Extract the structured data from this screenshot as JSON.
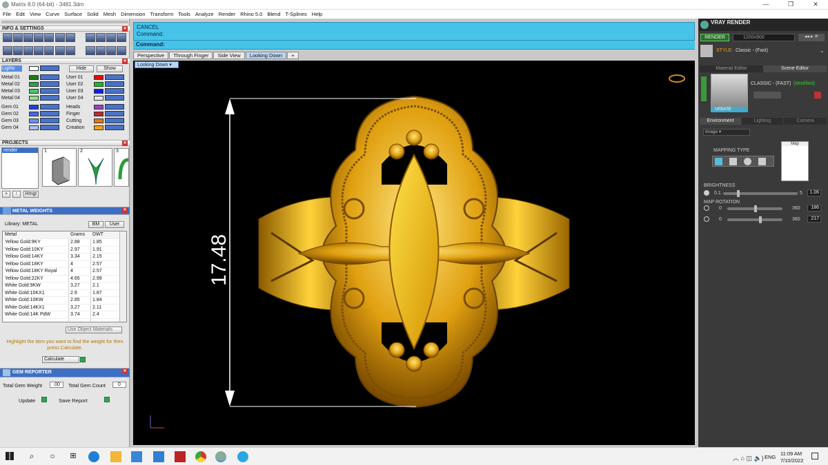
{
  "window": {
    "title": "Matrix 8.0 (64-bit) - 3481.3dm",
    "controls": [
      "—",
      "❐",
      "✕"
    ]
  },
  "menu": [
    "File",
    "Edit",
    "View",
    "Curve",
    "Surface",
    "Solid",
    "Mesh",
    "Dimension",
    "Transform",
    "Tools",
    "Analyze",
    "Render",
    "Rhino 5.0",
    "Blend",
    "T-Splines",
    "Help"
  ],
  "info_settings": {
    "title": "INFO & SETTINGS"
  },
  "layers": {
    "title": "LAYERS",
    "lights_label": "Lights",
    "hide_label": "Hide",
    "show_label": "Show",
    "left": [
      {
        "name": "Metal 01",
        "color": "#1c7a1c"
      },
      {
        "name": "Metal 02",
        "color": "#27a548"
      },
      {
        "name": "Metal 03",
        "color": "#4cc46b"
      },
      {
        "name": "Metal 04",
        "color": "#8fe08f"
      },
      {
        "name": "Gem 01",
        "color": "#1f3fd8"
      },
      {
        "name": "Gem 02",
        "color": "#3f68ef"
      },
      {
        "name": "Gem 03",
        "color": "#6b90f4"
      },
      {
        "name": "Gem 04",
        "color": "#a8c1f8"
      }
    ],
    "right": [
      {
        "name": "User 01",
        "color": "#e01010"
      },
      {
        "name": "User 02",
        "color": "#10c020"
      },
      {
        "name": "User 03",
        "color": "#1020d8"
      },
      {
        "name": "User 04",
        "color": "#e8e8e8"
      },
      {
        "name": "Heads",
        "color": "#a040c0"
      },
      {
        "name": "Finger",
        "color": "#c02828"
      },
      {
        "name": "Cutting",
        "color": "#e07a18"
      },
      {
        "name": "Creation",
        "color": "#f0a020"
      }
    ]
  },
  "projects": {
    "title": "PROJECTS",
    "item": "render",
    "thumbs": [
      "1",
      "2",
      "3"
    ],
    "hmgr": "Hmgr"
  },
  "metal_weights": {
    "title": "METAL WEIGHTS",
    "library_label": "Library: METAL",
    "bm": "BM",
    "user": "User",
    "columns": [
      "Metal",
      "Grams",
      "DWT"
    ],
    "rows": [
      [
        "Yellow Gold:9KY",
        "2.88",
        "1.85"
      ],
      [
        "Yellow Gold:10KY",
        "2.97",
        "1.91"
      ],
      [
        "Yellow Gold:14KY",
        "3.34",
        "2.15"
      ],
      [
        "Yellow Gold:18KY",
        "4",
        "2.57"
      ],
      [
        "Yellow Gold:18KY Royal",
        "4",
        "2.57"
      ],
      [
        "Yellow Gold:22KY",
        "4.65",
        "2.99"
      ],
      [
        "White Gold:9KW",
        "3.27",
        "2.1"
      ],
      [
        "White Gold:10KX1",
        "2.9",
        "1.87"
      ],
      [
        "White Gold:10KW",
        "2.85",
        "1.84"
      ],
      [
        "White Gold:14KX1",
        "3.27",
        "2.11"
      ],
      [
        "White Gold:14K PdW",
        "3.74",
        "2.4"
      ]
    ],
    "use_object_materials": "Use Object Materials",
    "highlight_text": "Highlight the item you want to find the weight for then press Calculate.",
    "calculate": "Calculate"
  },
  "gem_reporter": {
    "title": "GEM REPORTER",
    "total_weight_label": "Total Gem Weight",
    "total_weight_value": ".00",
    "total_count_label": "Total Gem Count",
    "total_count_value": "0",
    "update": "Update",
    "save_report": "Save Report"
  },
  "command": {
    "line1": "CANCEL",
    "line2": "Command:",
    "prompt": "Command:"
  },
  "viewports": {
    "tabs": [
      "Perspective",
      "Through Finger",
      "Side View",
      "Looking Down",
      "+"
    ],
    "active": "Looking Down",
    "label": "Looking Down"
  },
  "dimension": {
    "value": "17.48"
  },
  "vray": {
    "title": "VRAY RENDER",
    "render_btn": "RENDER",
    "resolution": "1200x900",
    "style_label": "STYLE:",
    "style_value": "Classic - (Fast)",
    "tabs": [
      "Material Editor",
      "Scene Editor"
    ],
    "preset": "CLASSIC - (FAST)",
    "modified": "(Modified)",
    "update": "UPDATE",
    "env_tabs": [
      "Environment",
      "Lighting",
      "Camera"
    ],
    "image_select": "Image",
    "mapping_type": "MAPPING TYPE",
    "map": "Map",
    "brightness_label": "BRIGHTNESS",
    "brightness_min": "0.1",
    "brightness_max": "5",
    "brightness_val": "1.06",
    "map_rotation_label": "MAP ROTATION",
    "rot_min": "0",
    "rot_max": "360",
    "rot1": "186",
    "rot2": "217"
  },
  "taskbar": {
    "lang": "ENG",
    "time": "11:09 AM",
    "date": "7/10/2022"
  }
}
